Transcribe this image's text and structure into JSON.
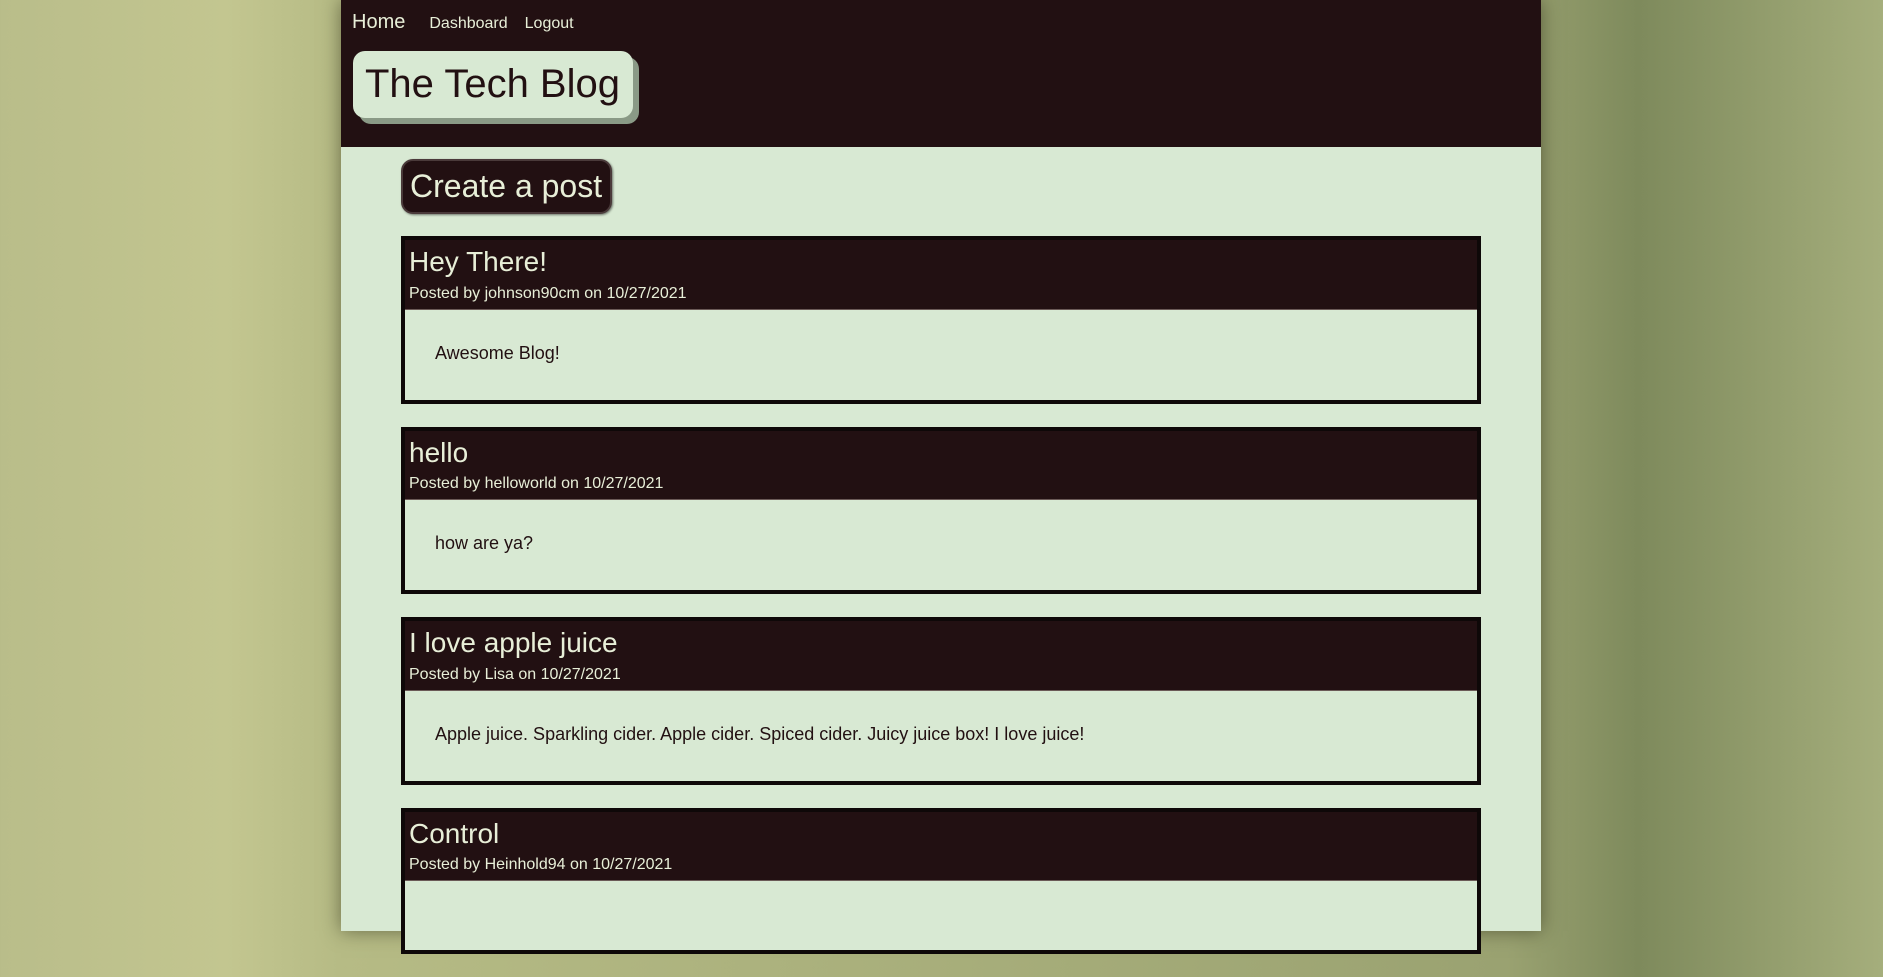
{
  "nav": {
    "home_label": "Home",
    "dashboard_label": "Dashboard",
    "logout_label": "Logout"
  },
  "header": {
    "title": "The Tech Blog"
  },
  "main": {
    "create_label": "Create a post",
    "posts": [
      {
        "title": "Hey There!",
        "meta": "Posted by johnson90cm on 10/27/2021",
        "body": "Awesome Blog!"
      },
      {
        "title": "hello",
        "meta": "Posted by helloworld on 10/27/2021",
        "body": "how are ya?"
      },
      {
        "title": "I love apple juice",
        "meta": "Posted by Lisa on 10/27/2021",
        "body": "Apple juice. Sparkling cider. Apple cider. Spiced cider. Juicy juice box! I love juice!"
      },
      {
        "title": "Control",
        "meta": "Posted by Heinhold94 on 10/27/2021",
        "body": ""
      }
    ]
  },
  "colors": {
    "dark": "#221012",
    "light": "#d8e9d3",
    "text_light": "#e8efd8"
  }
}
